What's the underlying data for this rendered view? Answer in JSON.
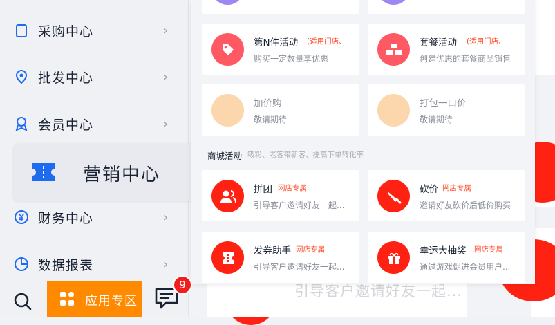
{
  "sidebar": {
    "items": [
      {
        "label": "采购中心",
        "icon": "clipboard-icon"
      },
      {
        "label": "批发中心",
        "icon": "map-pin-icon"
      },
      {
        "label": "会员中心",
        "icon": "member-badge-icon"
      },
      {
        "label": "营销中心",
        "icon": "ticket-icon",
        "active": true
      },
      {
        "label": "财务中心",
        "icon": "yen-circle-icon"
      },
      {
        "label": "数据报表",
        "icon": "pie-chart-icon"
      }
    ]
  },
  "bottom": {
    "app_zone_label": "应用专区",
    "message_badge": "9"
  },
  "background": {
    "card_text": "引导客户邀请好友一起..."
  },
  "menu": {
    "cards_top": [
      {
        "title": "第N件活动",
        "tag": "(适用门店、",
        "desc": "购买一定数量享优惠",
        "icon": "tag-icon"
      },
      {
        "title": "套餐活动",
        "tag": "(适用门店、",
        "desc": "创建优惠的套餐商品销售",
        "icon": "gold-bars-icon"
      },
      {
        "title": "加价购",
        "tag": "",
        "desc": "敬请期待",
        "icon": "placeholder-icon"
      },
      {
        "title": "打包一口价",
        "tag": "",
        "desc": "敬请期待",
        "icon": "placeholder-icon"
      }
    ],
    "section": {
      "title": "商城活动",
      "subtitle": "吸粉、老客带新客、提高下单转化率"
    },
    "cards_mall": [
      {
        "title": "拼团",
        "tag": "网店专属",
        "desc": "引导客户邀请好友一起...",
        "icon": "group-icon"
      },
      {
        "title": "砍价",
        "tag": "网店专属",
        "desc": "邀请好友砍价后低价购买",
        "icon": "knife-icon"
      },
      {
        "title": "发券助手",
        "tag": "网店专属",
        "desc": "引导客户邀请好友一起...",
        "icon": "coupon-icon"
      },
      {
        "title": "幸运大抽奖",
        "tag": "网店专属",
        "desc": "通过游戏促进会员用户...",
        "icon": "gift-icon"
      }
    ]
  },
  "colors": {
    "accent_orange": "#ff8a00",
    "brand_blue": "#1f6bf0",
    "red_icon": "#ff2212",
    "pink_icon": "#ff5a64",
    "placeholder": "#fcd7ad"
  }
}
